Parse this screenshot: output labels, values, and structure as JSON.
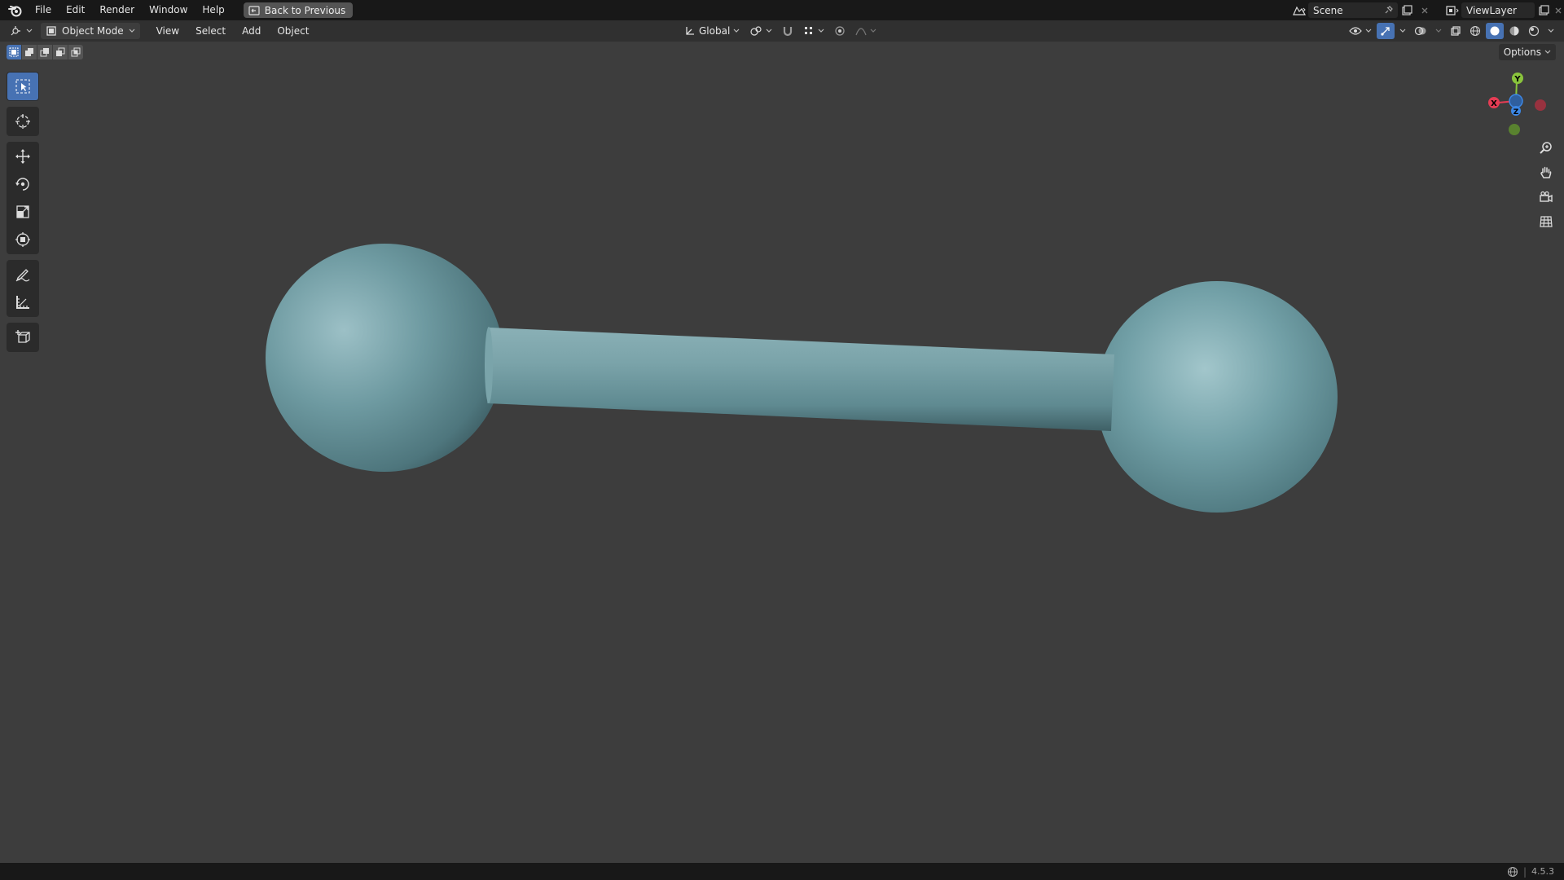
{
  "menubar": {
    "items": [
      "File",
      "Edit",
      "Render",
      "Window",
      "Help"
    ],
    "back_label": "Back to Previous",
    "scene_name": "Scene",
    "view_layer_name": "ViewLayer"
  },
  "header": {
    "mode_label": "Object Mode",
    "menus": [
      "View",
      "Select",
      "Add",
      "Object"
    ],
    "transform_orientation": "Global",
    "options_label": "Options"
  },
  "gizmo": {
    "y_label": "Y",
    "x_label": "X",
    "z_label": "Z"
  },
  "status": {
    "version": "4.5.3"
  },
  "colors": {
    "accent": "#4772b3",
    "object": "#6e9aa1",
    "axis_x": "#e53c54",
    "axis_y": "#8ac43c",
    "axis_z": "#3c87e5"
  }
}
